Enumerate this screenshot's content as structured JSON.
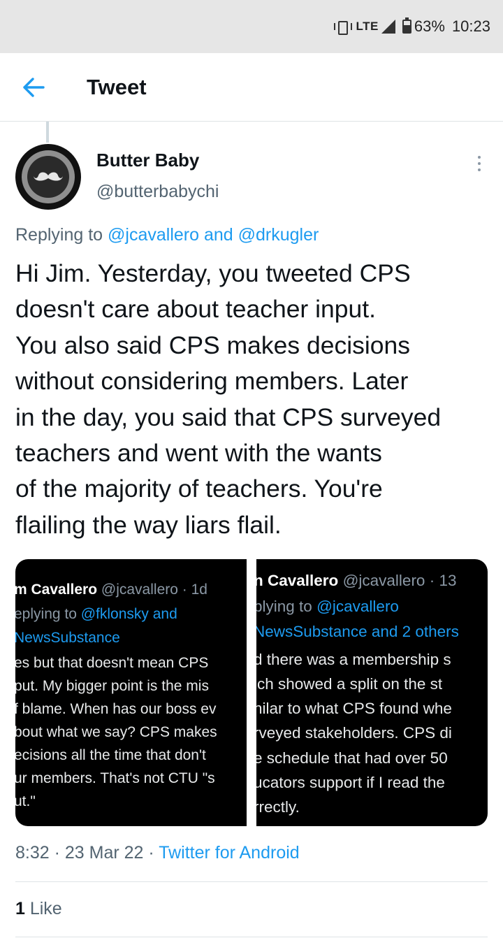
{
  "status_bar": {
    "network": "LTE",
    "battery": "63%",
    "time": "10:23"
  },
  "header": {
    "title": "Tweet"
  },
  "tweet": {
    "author_name": "Butter Baby",
    "author_handle": "@butterbabychi",
    "replying_prefix": "Replying to",
    "replying_to": "@jcavallero and @drkugler",
    "text_lines": [
      "Hi Jim. Yesterday, you tweeted CPS",
      "doesn't care about teacher input.",
      "You also said CPS makes decisions",
      "without considering members. Later",
      "in the day, you said that CPS surveyed",
      "teachers and went with the wants",
      "of the majority of teachers. You're",
      "flailing the way liars flail."
    ],
    "timestamp": "8:32 · 23 Mar 22 · ",
    "source": "Twitter for Android",
    "likes_count": "1",
    "likes_label": " Like"
  },
  "media": {
    "left": {
      "name": "m Cavallero",
      "handle": " @jcavallero · 1d",
      "reply_prefix": "eplying to ",
      "reply_target": "@fklonsky and",
      "reply_target2": "NewsSubstance",
      "lines": [
        "es but that doesn't mean CPS",
        "put. My bigger point is the mis",
        "f blame. When has our boss ev",
        "bout what we say? CPS makes",
        "ecisions all the time that don't",
        "ur members. That's not CTU \"s",
        "ut.\""
      ]
    },
    "right": {
      "name": "n Cavallero",
      "handle": " @jcavallero · 13",
      "reply_prefix": "plying to ",
      "reply_target": "@jcavallero",
      "reply_target2": "NewsSubstance and 2 others",
      "lines": [
        "d there was a membership s",
        "ich showed a split on the st",
        "nilar to what CPS found whe",
        "rveyed stakeholders. CPS di",
        "e schedule that had over 50",
        "ucators support if I read the",
        "rrectly."
      ]
    }
  },
  "colors": {
    "accent": "#1d9bf0",
    "muted": "#536471",
    "text": "#0f1419"
  },
  "icons": [
    "vibrate-icon",
    "signal-icon",
    "battery-icon",
    "back-arrow-icon",
    "more-options-icon",
    "avatar-mustache-icon"
  ]
}
